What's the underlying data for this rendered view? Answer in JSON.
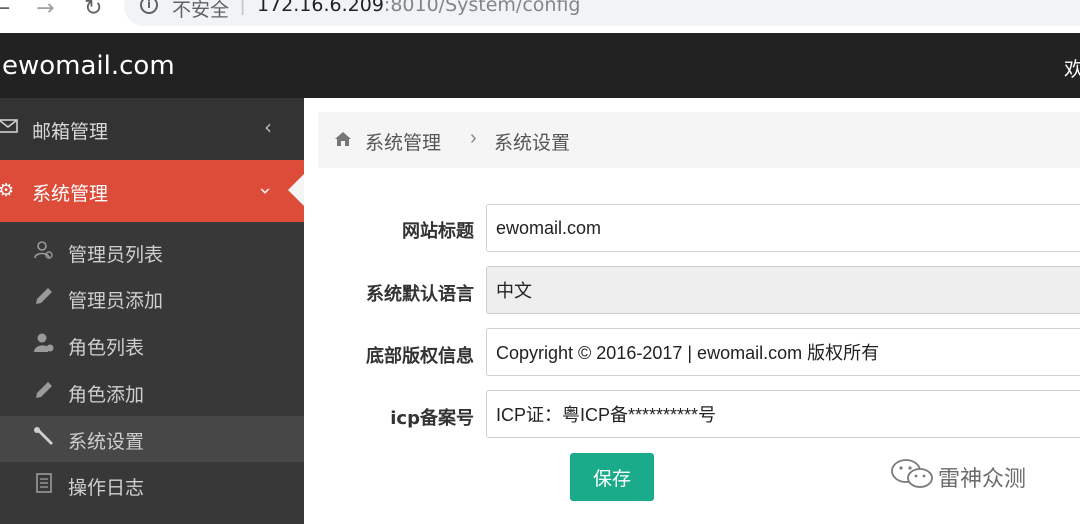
{
  "browser": {
    "security_label": "不安全",
    "url_host": "172.16.6.209",
    "url_rest": ":8010/System/config"
  },
  "header": {
    "logo": "ewomail.com",
    "welcome": "欢"
  },
  "sidebar": {
    "menus": [
      {
        "label": "邮箱管理",
        "icon": "mail-icon",
        "expanded": false
      },
      {
        "label": "系统管理",
        "icon": "gears-icon",
        "expanded": true,
        "active": true
      }
    ],
    "submenu": [
      {
        "label": "管理员列表",
        "icon": "user-list-icon"
      },
      {
        "label": "管理员添加",
        "icon": "pencil-icon"
      },
      {
        "label": "角色列表",
        "icon": "user-role-icon"
      },
      {
        "label": "角色添加",
        "icon": "pencil-icon"
      },
      {
        "label": "系统设置",
        "icon": "wrench-icon",
        "active": true
      },
      {
        "label": "操作日志",
        "icon": "document-icon"
      }
    ]
  },
  "breadcrumb": {
    "items": [
      "系统管理",
      "系统设置"
    ],
    "separator": "›"
  },
  "form": {
    "fields": [
      {
        "label": "网站标题",
        "value": "ewomail.com",
        "readonly": false
      },
      {
        "label": "系统默认语言",
        "value": "中文",
        "readonly": true
      },
      {
        "label": "底部版权信息",
        "value": "Copyright © 2016-2017 | ewomail.com 版权所有",
        "readonly": false
      },
      {
        "label": "icp备案号",
        "value": "ICP证：粤ICP备**********号",
        "readonly": false
      }
    ],
    "save_label": "保存"
  },
  "watermark": {
    "text": "雷神众测"
  },
  "colors": {
    "header_bg": "#222222",
    "sidebar_bg": "#2f2f2f",
    "active_menu": "#dd4b39",
    "save_button": "#1aab8a"
  }
}
